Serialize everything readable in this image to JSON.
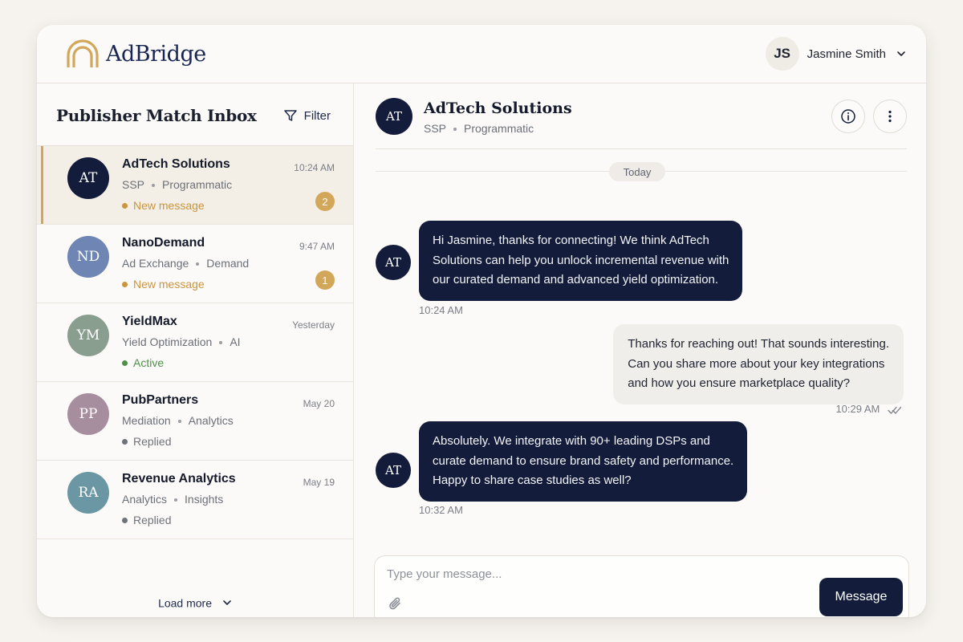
{
  "app": {
    "logo_text": "AdBridge",
    "accent_color": "#d2a75a",
    "navy_color": "#131c3a"
  },
  "user": {
    "initials": "JS",
    "name": "Jasmine Smith"
  },
  "inbox": {
    "title": "Publisher Match Inbox",
    "filter_label": "Filter",
    "load_more_label": "Load more",
    "conversations": [
      {
        "initials": "AT",
        "name": "AdTech Solutions",
        "tag1": "SSP",
        "tag2": "Programmatic",
        "time": "10:24 AM",
        "status": "New message",
        "status_color": "#c9953f",
        "badge": "2",
        "avatar_color": "#131c3a"
      },
      {
        "initials": "ND",
        "name": "NanoDemand",
        "tag1": "Ad Exchange",
        "tag2": "Demand",
        "time": "9:47 AM",
        "status": "New message",
        "status_color": "#c9953f",
        "badge": "1",
        "avatar_color": "#6f86b4"
      },
      {
        "initials": "YM",
        "name": "YieldMax",
        "tag1": "Yield Optimization",
        "tag2": "AI",
        "time": "Yesterday",
        "status": "Active",
        "status_color": "#4f8f4a",
        "badge": "",
        "avatar_color": "#8a9e90"
      },
      {
        "initials": "PP",
        "name": "PubPartners",
        "tag1": "Mediation",
        "tag2": "Analytics",
        "time": "May 20",
        "status": "Replied",
        "status_color": "#6f727a",
        "badge": "",
        "avatar_color": "#a68e9e"
      },
      {
        "initials": "RA",
        "name": "Revenue Analytics",
        "tag1": "Analytics",
        "tag2": "Insights",
        "time": "May 19",
        "status": "Replied",
        "status_color": "#6f727a",
        "badge": "",
        "avatar_color": "#6a97a3"
      }
    ]
  },
  "chat": {
    "initials": "AT",
    "name": "AdTech Solutions",
    "tag1": "SSP",
    "tag2": "Programmatic",
    "day_label": "Today",
    "messages": [
      {
        "direction": "in",
        "lines": [
          "Hi Jasmine, thanks for connecting! We think AdTech",
          "Solutions can help you unlock incremental revenue with",
          "our curated demand and advanced yield optimization."
        ],
        "time": "10:24 AM"
      },
      {
        "direction": "out",
        "lines": [
          "Thanks for reaching out! That sounds interesting.",
          "Can you share more about your key integrations",
          "and how you ensure marketplace quality?"
        ],
        "time": "10:29 AM"
      },
      {
        "direction": "in",
        "lines": [
          "Absolutely. We integrate with 90+ leading DSPs and",
          "curate demand to ensure brand safety and performance.",
          "Happy to share case studies as well?"
        ],
        "time": "10:32 AM"
      }
    ],
    "composer_placeholder": "Type your message...",
    "send_label": "Message"
  }
}
